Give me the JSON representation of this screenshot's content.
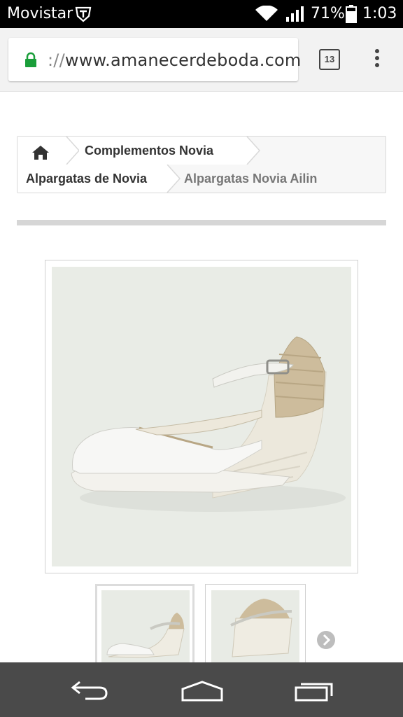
{
  "status_bar": {
    "carrier": "Movistar",
    "battery_percent": "71%",
    "time": "1:03"
  },
  "browser": {
    "url_scheme": "://",
    "url_host": "www.amanecerdeboda.com",
    "tab_count": "13"
  },
  "breadcrumb": {
    "items": [
      {
        "label": "Complementos Novia"
      },
      {
        "label": "Alpargatas de Novia"
      },
      {
        "label": "Alpargatas Novia Ailin"
      }
    ]
  },
  "product": {
    "image_icon": "espadrille-shoe-photo",
    "thumbnails": [
      "espadrille-side-view",
      "espadrille-back-view"
    ]
  },
  "icons": {
    "home": "home-icon",
    "lock": "lock-icon",
    "next": "chevron-right-icon"
  },
  "colors": {
    "lock_green": "#1a9e3a",
    "navbar": "#4a4a4a",
    "status_bar": "#000000"
  }
}
